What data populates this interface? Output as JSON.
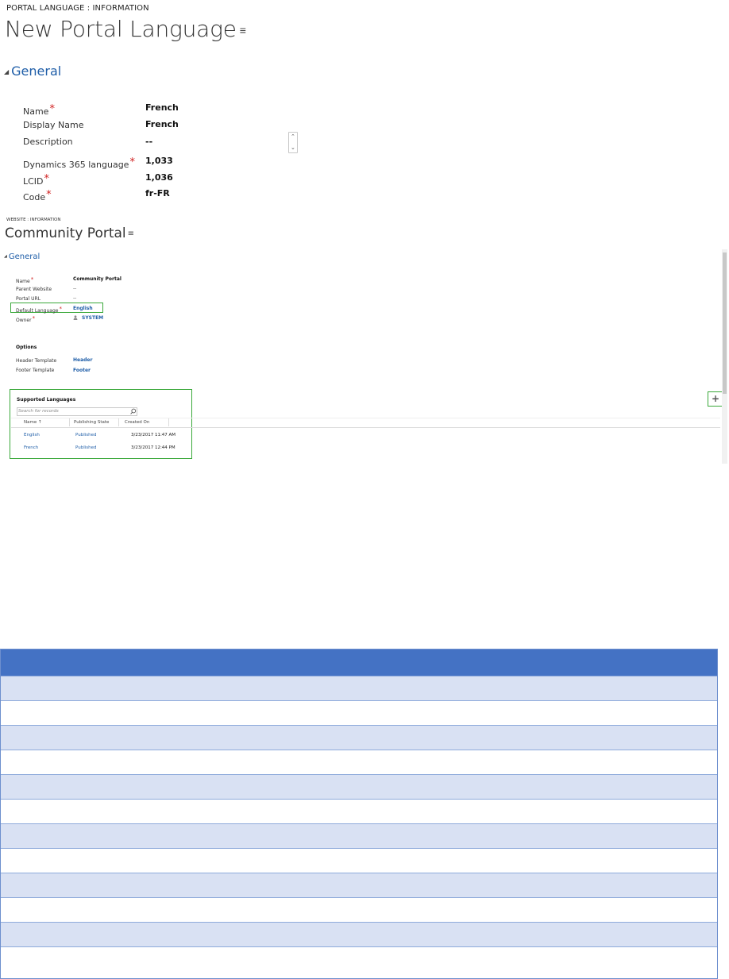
{
  "panel1": {
    "entity_label": "PORTAL LANGUAGE : INFORMATION",
    "title": "New Portal Language",
    "section": "General",
    "fields": [
      {
        "label": "Name",
        "required": true,
        "value": "French"
      },
      {
        "label": "Display Name",
        "required": false,
        "value": "French"
      },
      {
        "label": "Description",
        "required": false,
        "value": "--"
      },
      {
        "label": "Dynamics 365 language",
        "required": true,
        "value": "1,033"
      },
      {
        "label": "LCID",
        "required": true,
        "value": "1,036"
      },
      {
        "label": "Code",
        "required": true,
        "value": "fr-FR"
      }
    ],
    "required_mark": "*"
  },
  "panel2": {
    "entity_label": "WEBSITE : INFORMATION",
    "title": "Community Portal",
    "section": "General",
    "fields": [
      {
        "label": "Name",
        "required": true,
        "value": "Community Portal"
      },
      {
        "label": "Parent Website",
        "required": false,
        "value": "--"
      },
      {
        "label": "Portal URL",
        "required": false,
        "value": "--"
      },
      {
        "label": "Default Language",
        "required": true,
        "value": "English"
      },
      {
        "label": "Owner",
        "required": true,
        "value": "SYSTEM"
      }
    ],
    "options": {
      "heading": "Options",
      "fields": [
        {
          "label": "Header Template",
          "value": "Header"
        },
        {
          "label": "Footer Template",
          "value": "Footer"
        }
      ]
    },
    "subgrid": {
      "title": "Supported Languages",
      "search_placeholder": "Search for records",
      "add_glyph": "+",
      "columns": [
        "Name ↑",
        "Publishing State",
        "Created On"
      ],
      "rows": [
        {
          "name": "English",
          "state": "Published",
          "created": "3/23/2017 11:47 AM"
        },
        {
          "name": "French",
          "state": "Published",
          "created": "3/23/2017 12:44 PM"
        }
      ]
    }
  },
  "icons": {
    "title_menu": "list-menu-icon",
    "section_toggle": "collapse-triangle-icon",
    "owner": "user-icon",
    "search": "search-icon",
    "add": "plus-icon"
  },
  "table": {
    "body_rows": 12,
    "colors": {
      "header": "#4472c4",
      "band": "#d9e1f3",
      "plain": "#ffffff",
      "border": "#8eaadb"
    }
  },
  "colors": {
    "link": "#1f5ea8",
    "required": "#d01f1f",
    "highlight": "#3aa83a"
  }
}
